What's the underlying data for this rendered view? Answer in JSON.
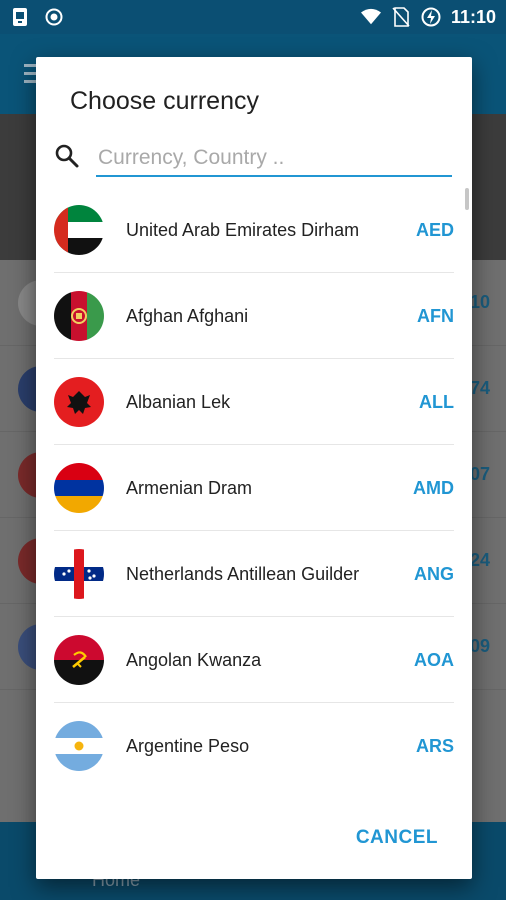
{
  "status_bar": {
    "time": "11:10",
    "left_icons": [
      "screenshot-icon",
      "record-icon"
    ],
    "right_icons": [
      "wifi-icon",
      "no-sim-icon",
      "battery-charging-icon"
    ]
  },
  "background_app": {
    "bottom_nav_label": "Home",
    "visible_values": [
      "10",
      "74",
      "07",
      "24",
      "09"
    ]
  },
  "dialog": {
    "title": "Choose currency",
    "search": {
      "placeholder": "Currency, Country ..",
      "value": ""
    },
    "currencies": [
      {
        "name": "United Arab Emirates Dirham",
        "code": "AED",
        "flag": "uae-flag-icon"
      },
      {
        "name": "Afghan Afghani",
        "code": "AFN",
        "flag": "afghanistan-flag-icon"
      },
      {
        "name": "Albanian Lek",
        "code": "ALL",
        "flag": "albania-flag-icon"
      },
      {
        "name": "Armenian Dram",
        "code": "AMD",
        "flag": "armenia-flag-icon"
      },
      {
        "name": "Netherlands Antillean Guilder",
        "code": "ANG",
        "flag": "netherlands-antilles-flag-icon"
      },
      {
        "name": "Angolan Kwanza",
        "code": "AOA",
        "flag": "angola-flag-icon"
      },
      {
        "name": "Argentine Peso",
        "code": "ARS",
        "flag": "argentina-flag-icon"
      }
    ],
    "cancel_label": "CANCEL"
  },
  "colors": {
    "accent": "#2196d3",
    "toolbar": "#0a5478",
    "status_bar": "#0b4f73"
  }
}
